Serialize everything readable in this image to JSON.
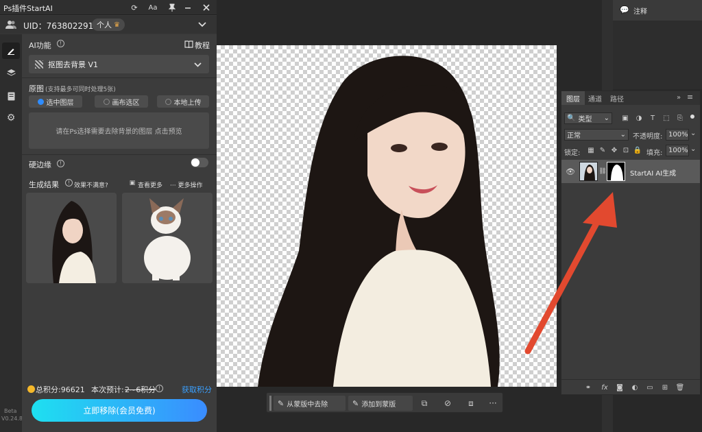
{
  "plugin": {
    "title": "Ps插件StartAI",
    "titlebar_icons": [
      "refresh-icon",
      "font-size-icon",
      "pin-icon",
      "minimize-icon",
      "close-icon"
    ],
    "titlebar_font_label": "Aa",
    "uid": "UID：763802291",
    "account_type": "个人",
    "ai_function_label": "AI功能",
    "tutorial_label": "教程",
    "feature_selected": "抠图去背景 V1",
    "source_label": "原图",
    "source_hint": "(支持最多可同时处理5张)",
    "source_options": [
      "选中图层",
      "画布选区",
      "本地上传"
    ],
    "preview_placeholder": "请在Ps选择需要去除背景的图层 点击预览",
    "hard_edge_label": "硬边缘",
    "results_label": "生成结果",
    "unsatisfied_label": "效果不满意?",
    "view_more_label": "查看更多",
    "more_actions_label": "··· 更多操作",
    "points_label": "总积分:96621",
    "estimate_label": "本次预计:",
    "estimate_value": "2~6积分",
    "get_points_label": "获取积分",
    "remove_button": "立即移除(会员免费)",
    "version_tag": "Beta",
    "version": "V0.24.8",
    "accent_color": "#1ec8f0",
    "link_color": "#3aa0ff"
  },
  "context_bar": {
    "remove_from_mask": "从蒙版中去除",
    "add_to_mask": "添加到蒙版",
    "more": "···"
  },
  "notes_panel": {
    "label": "注释"
  },
  "layers_panel": {
    "tabs": [
      "图层",
      "通道",
      "路径"
    ],
    "filter_kind": "类型",
    "blend_mode": "正常",
    "opacity_label": "不透明度:",
    "opacity_value": "100%",
    "lock_label": "锁定:",
    "fill_label": "填充:",
    "fill_value": "100%",
    "layer_name": "StartAI AI生成"
  }
}
